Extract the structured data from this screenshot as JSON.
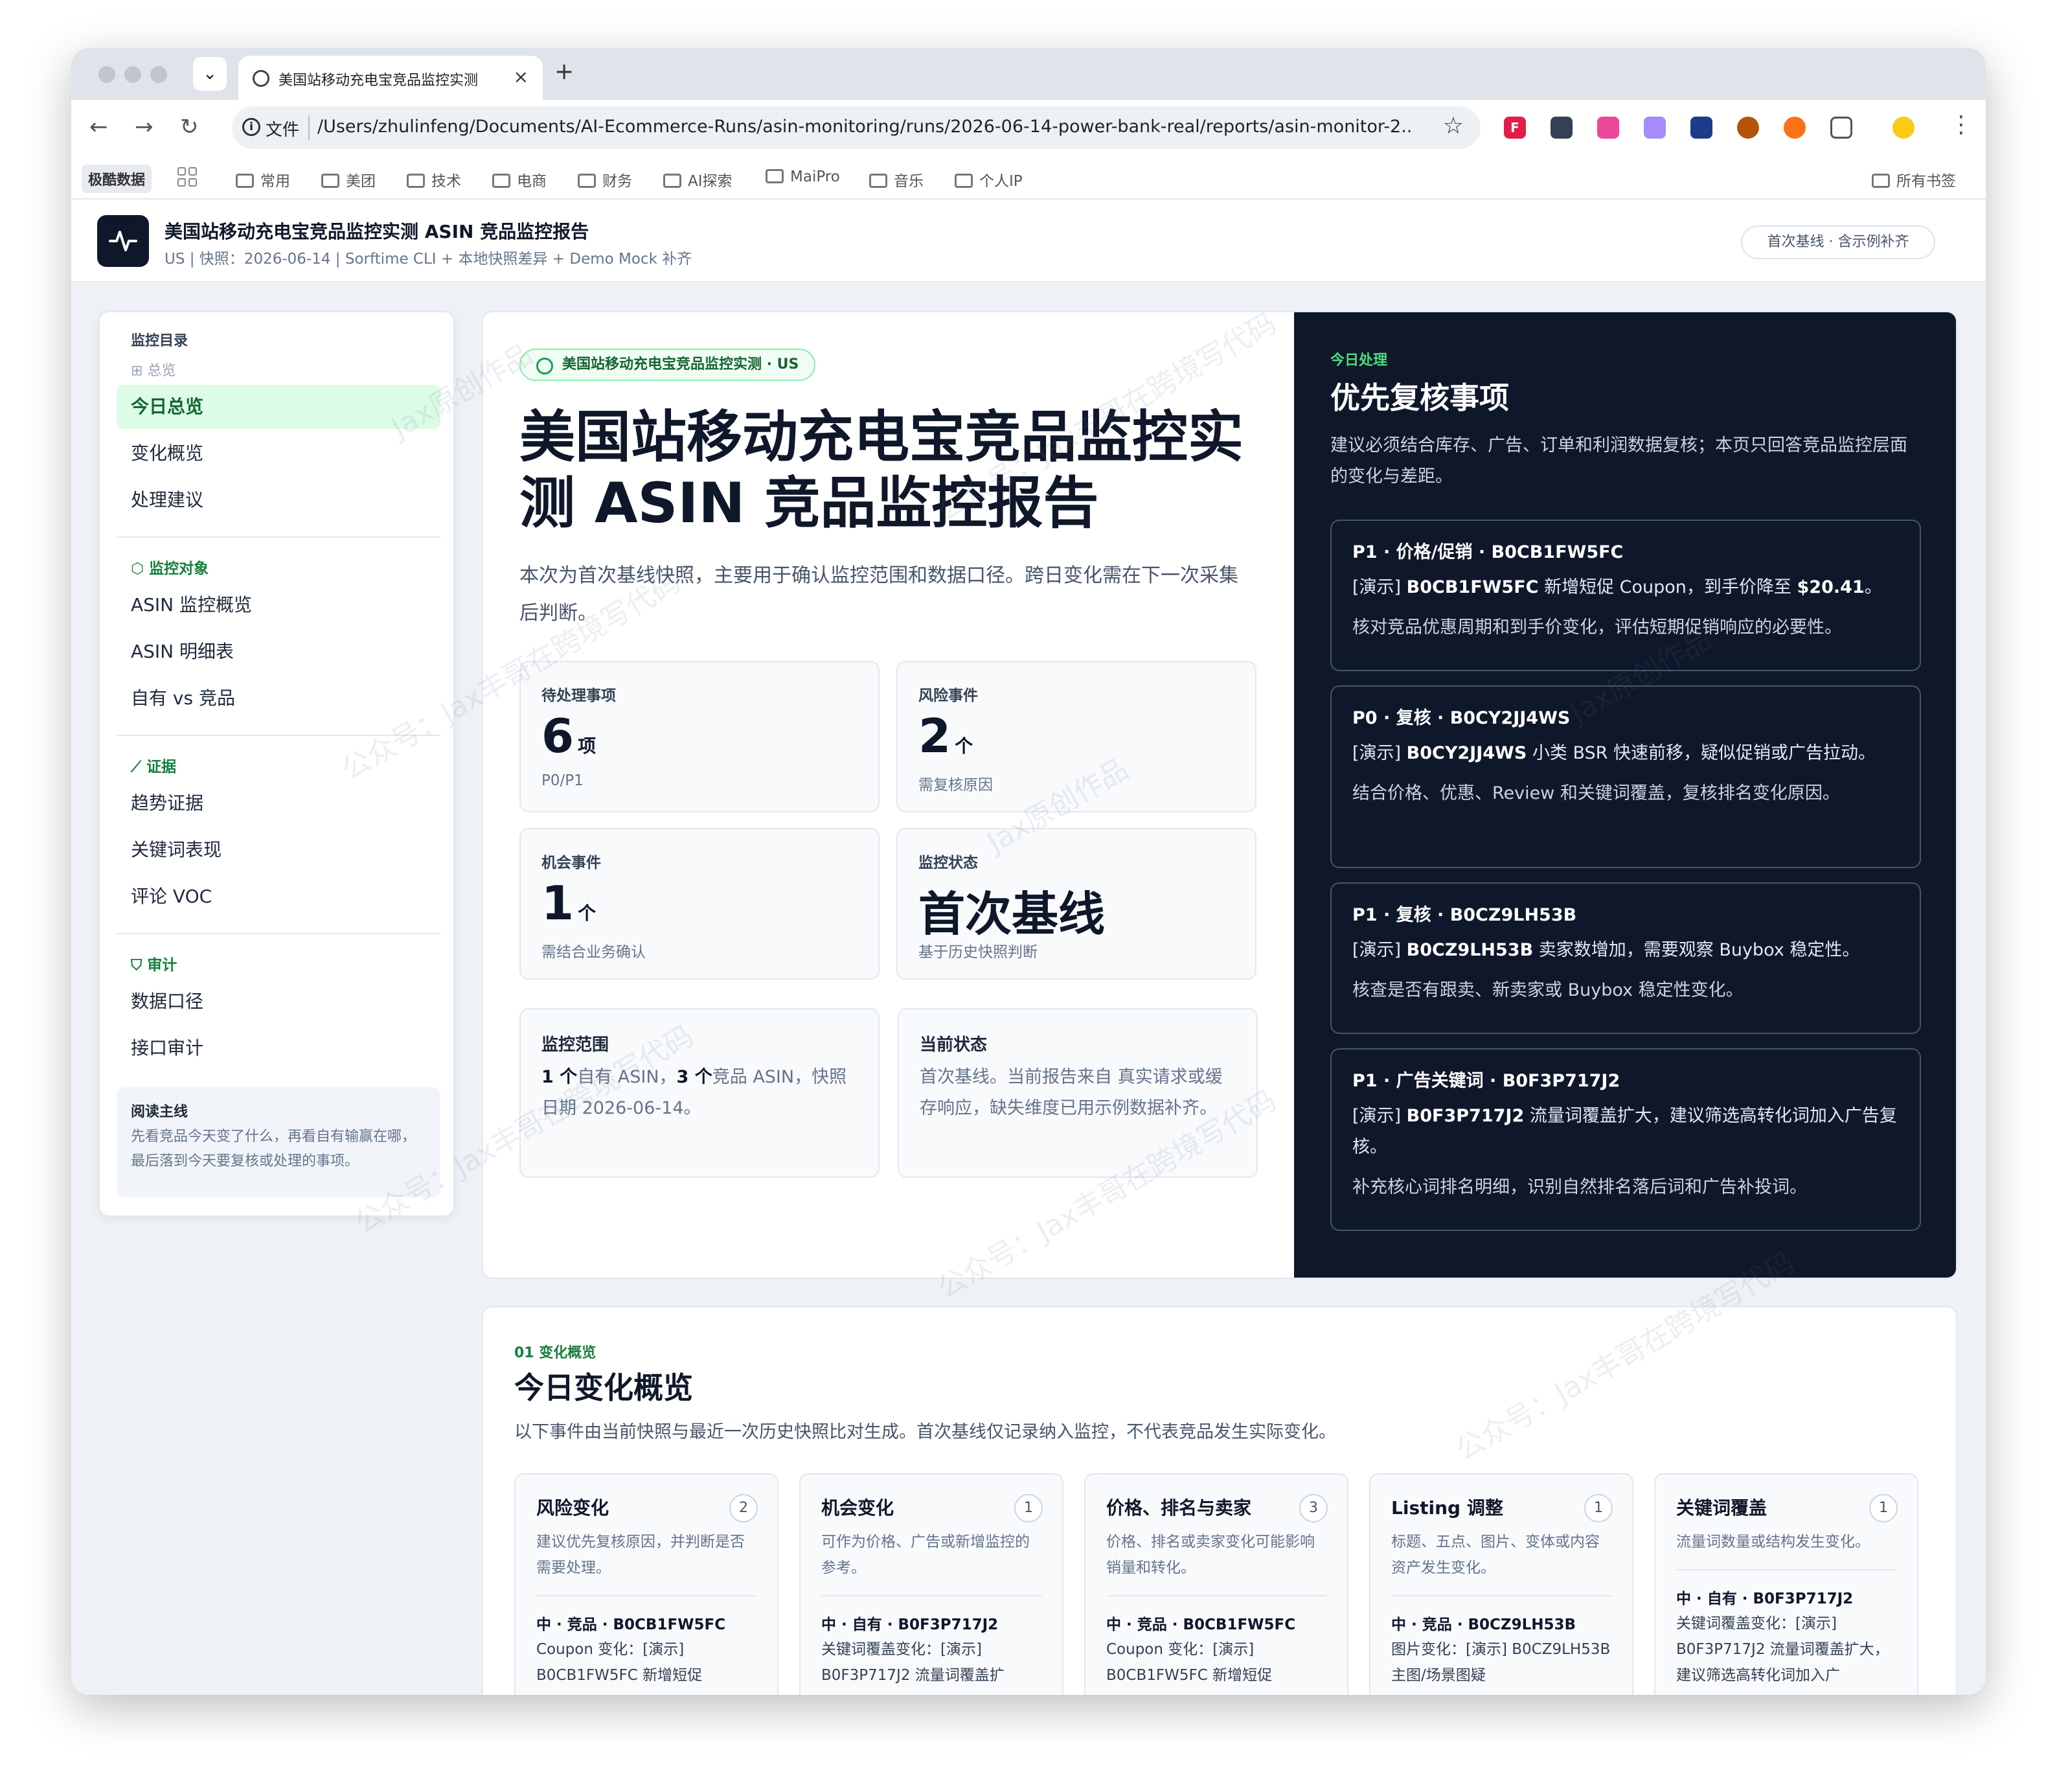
{
  "browser": {
    "tab_title": "美国站移动充电宝竞品监控实测",
    "url_scheme": "文件",
    "url": "/Users/zhulinfeng/Documents/AI-Ecommerce-Runs/asin-monitoring/runs/2026-06-14-power-bank-real/reports/asin-monitor-2...",
    "bookmarks": [
      "常用",
      "美团",
      "技术",
      "电商",
      "财务",
      "AI探索",
      "MaiPro",
      "音乐",
      "个人IP"
    ],
    "bookmark_brand": "极酷数据",
    "all_bookmarks": "所有书签"
  },
  "header": {
    "title": "美国站移动充电宝竞品监控实测 ASIN 竞品监控报告",
    "subtitle": "US  |  快照：2026-06-14  |  Sorftime CLI + 本地快照差异 + Demo Mock 补齐",
    "badge": "首次基线 · 含示例补齐"
  },
  "sidebar": {
    "heading": "监控目录",
    "overview_label": "总览",
    "overview_items": [
      "今日总览",
      "变化概览",
      "处理建议"
    ],
    "group_objects": "监控对象",
    "object_items": [
      "ASIN 监控概览",
      "ASIN 明细表",
      "自有 vs 竞品"
    ],
    "group_evidence": "证据",
    "evidence_items": [
      "趋势证据",
      "关键词表现",
      "评论 VOC"
    ],
    "group_audit": "审计",
    "audit_items": [
      "数据口径",
      "接口审计"
    ],
    "note_title": "阅读主线",
    "note_desc": "先看竞品今天变了什么，再看自有输赢在哪，最后落到今天要复核或处理的事项。"
  },
  "hero": {
    "chip": "美国站移动充电宝竞品监控实测 · US",
    "title": "美国站移动充电宝竞品监控实测 ASIN 竞品监控报告",
    "lead": "本次为首次基线快照，主要用于确认监控范围和数据口径。跨日变化需在下一次采集后判断。",
    "kpis": [
      {
        "label": "待处理事项",
        "value": "6",
        "unit": "项",
        "sub": "P0/P1"
      },
      {
        "label": "风险事件",
        "value": "2",
        "unit": "个",
        "sub": "需复核原因"
      },
      {
        "label": "机会事件",
        "value": "1",
        "unit": "个",
        "sub": "需结合业务确认"
      },
      {
        "label": "监控状态",
        "value": "首次基线",
        "unit": "",
        "sub": "基于历史快照判断"
      }
    ],
    "scope": {
      "label": "监控范围",
      "own_count": "1 个",
      "own_text": "自有 ASIN，",
      "comp_count": "3 个",
      "comp_text": "竞品 ASIN，快照日期 2026-06-14。"
    },
    "status": {
      "label": "当前状态",
      "desc": "首次基线。当前报告来自 真实请求或缓存响应，缺失维度已用示例数据补齐。"
    }
  },
  "priority": {
    "eyebrow": "今日处理",
    "title": "优先复核事项",
    "desc": "建议必须结合库存、广告、订单和利润数据复核；本页只回答竞品监控层面的变化与差距。",
    "items": [
      {
        "head": "P1 · 价格/促销 · B0CB1FW5FC",
        "prefix": "[演示] ",
        "asin": "B0CB1FW5FC",
        "body": " 新增短促 Coupon，到手价降至 ",
        "strong": "$20.41",
        "tail": "。",
        "note": "核对竞品优惠周期和到手价变化，评估短期促销响应的必要性。"
      },
      {
        "head": "P0 · 复核 · B0CY2JJ4WS",
        "prefix": "[演示] ",
        "asin": "B0CY2JJ4WS",
        "body": " 小类 BSR 快速前移，疑似促销或广告拉动。",
        "strong": "",
        "tail": "",
        "note": "结合价格、优惠、Review 和关键词覆盖，复核排名变化原因。"
      },
      {
        "head": "P1 · 复核 · B0CZ9LH53B",
        "prefix": "[演示] ",
        "asin": "B0CZ9LH53B",
        "body": " 卖家数增加，需要观察 Buybox 稳定性。",
        "strong": "",
        "tail": "",
        "note": "核查是否有跟卖、新卖家或 Buybox 稳定性变化。"
      },
      {
        "head": "P1 · 广告关键词 · B0F3P717J2",
        "prefix": "[演示] ",
        "asin": "B0F3P717J2",
        "body": " 流量词覆盖扩大，建议筛选高转化词加入广告复核。",
        "strong": "",
        "tail": "",
        "note": "补充核心词排名明细，识别自然排名落后词和广告补投词。"
      }
    ]
  },
  "changes": {
    "eyebrow": "01 变化概览",
    "title": "今日变化概览",
    "desc": "以下事件由当前快照与最近一次历史快照比对生成。首次基线仅记录纳入监控，不代表竞品发生实际变化。",
    "cards": [
      {
        "title": "风险变化",
        "count": "2",
        "desc": "建议优先复核原因，并判断是否需要处理。",
        "head": "中 · 竞品 · B0CB1FW5FC",
        "body": "Coupon 变化：[演示] B0CB1FW5FC 新增短促"
      },
      {
        "title": "机会变化",
        "count": "1",
        "desc": "可作为价格、广告或新增监控的参考。",
        "head": "中 · 自有 · B0F3P717J2",
        "body": "关键词覆盖变化：[演示] B0F3P717J2 流量词覆盖扩"
      },
      {
        "title": "价格、排名与卖家",
        "count": "3",
        "desc": "价格、排名或卖家变化可能影响销量和转化。",
        "head": "中 · 竞品 · B0CB1FW5FC",
        "body": "Coupon 变化：[演示] B0CB1FW5FC 新增短促"
      },
      {
        "title": "Listing 调整",
        "count": "1",
        "desc": "标题、五点、图片、变体或内容资产发生变化。",
        "head": "中 · 竞品 · B0CZ9LH53B",
        "body": "图片变化：[演示] B0CZ9LH53B 主图/场景图疑"
      },
      {
        "title": "关键词覆盖",
        "count": "1",
        "desc": "流量词数量或结构发生变化。",
        "head": "中 · 自有 · B0F3P717J2",
        "body": "关键词覆盖变化：[演示] B0F3P717J2 流量词覆盖扩大，建议筛选高转化词加入广"
      }
    ]
  },
  "watermark": {
    "a": "Jax原创作品",
    "b": "公众号：Jax丰哥在跨境写代码"
  },
  "colors": {
    "accent": "#15803d",
    "dark_panel": "#0f172a",
    "chip_bg": "#f0fdf4"
  }
}
